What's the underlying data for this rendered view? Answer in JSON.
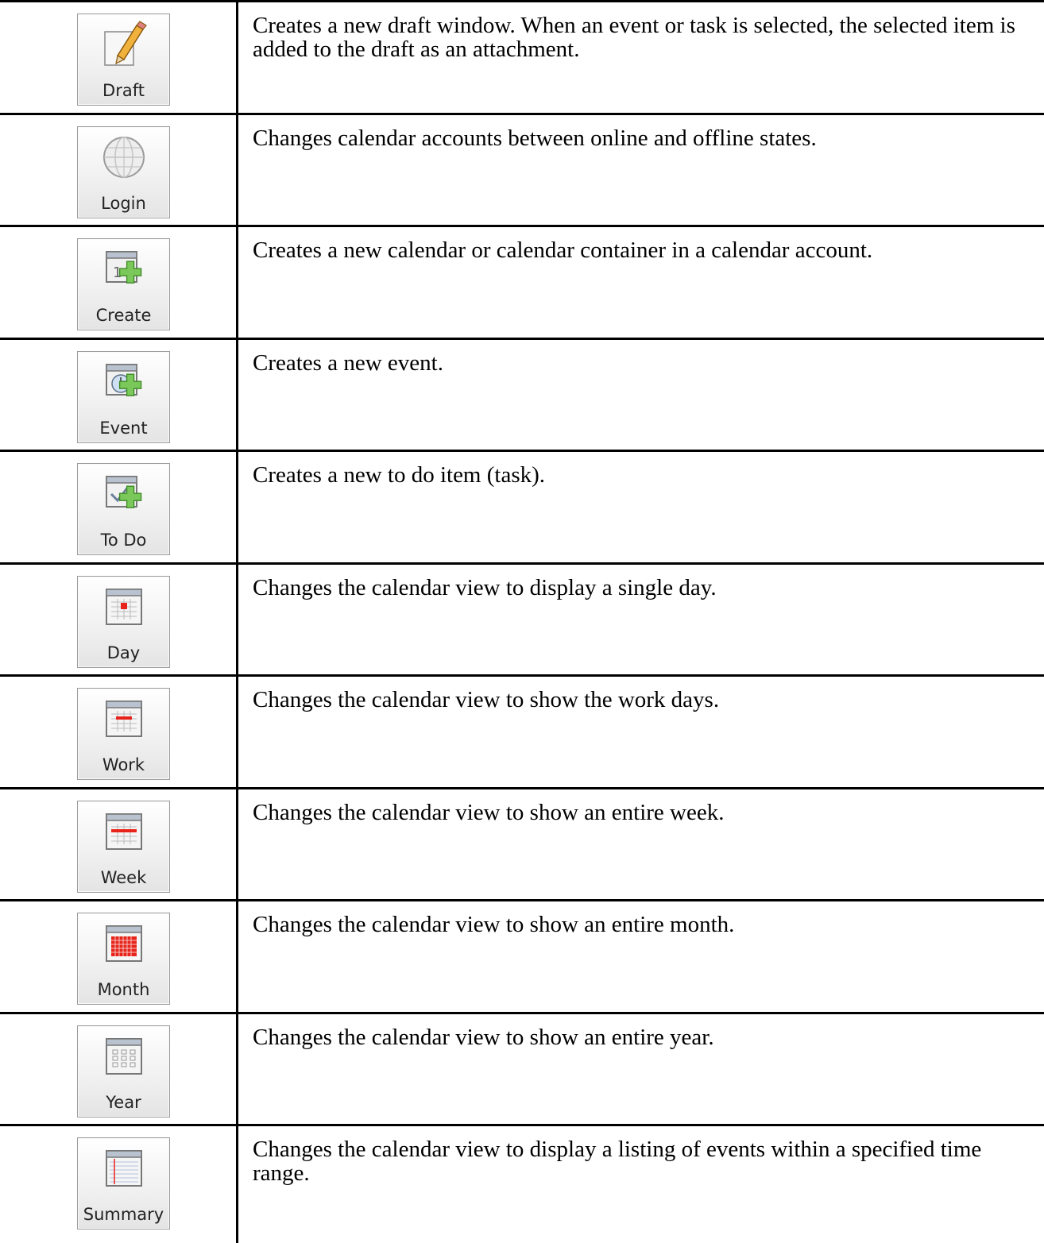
{
  "rows": [
    {
      "button": "Draft",
      "icon": "pencil-note-icon",
      "description": "Creates a new draft window. When an event or task is selected, the selected item is added to the draft as an attachment."
    },
    {
      "button": "Login",
      "icon": "globe-icon",
      "description": "Changes calendar accounts between online and offline states."
    },
    {
      "button": "Create",
      "icon": "calendar-add-icon",
      "description": "Creates a new calendar or calendar container in a calendar account."
    },
    {
      "button": "Event",
      "icon": "clock-add-icon",
      "description": "Creates a new event."
    },
    {
      "button": "To Do",
      "icon": "checkmark-add-icon",
      "description": "Creates a new to do item (task)."
    },
    {
      "button": "Day",
      "icon": "calendar-day-icon",
      "description": "Changes the calendar view to display a single day."
    },
    {
      "button": "Work",
      "icon": "calendar-work-icon",
      "description": "Changes the calendar view to show the work days."
    },
    {
      "button": "Week",
      "icon": "calendar-week-icon",
      "description": "Changes the calendar view to show an entire week."
    },
    {
      "button": "Month",
      "icon": "calendar-month-icon",
      "description": "Changes the calendar view to show an entire month."
    },
    {
      "button": "Year",
      "icon": "calendar-year-icon",
      "description": "Changes the calendar view to show an entire year."
    },
    {
      "button": "Summary",
      "icon": "calendar-summary-icon",
      "description": "Changes the calendar view to display a listing of events within a specified time range."
    }
  ],
  "colors": {
    "rule": "#000000",
    "accent_red": "#e8241a",
    "plus_green": "#7bc85a"
  }
}
